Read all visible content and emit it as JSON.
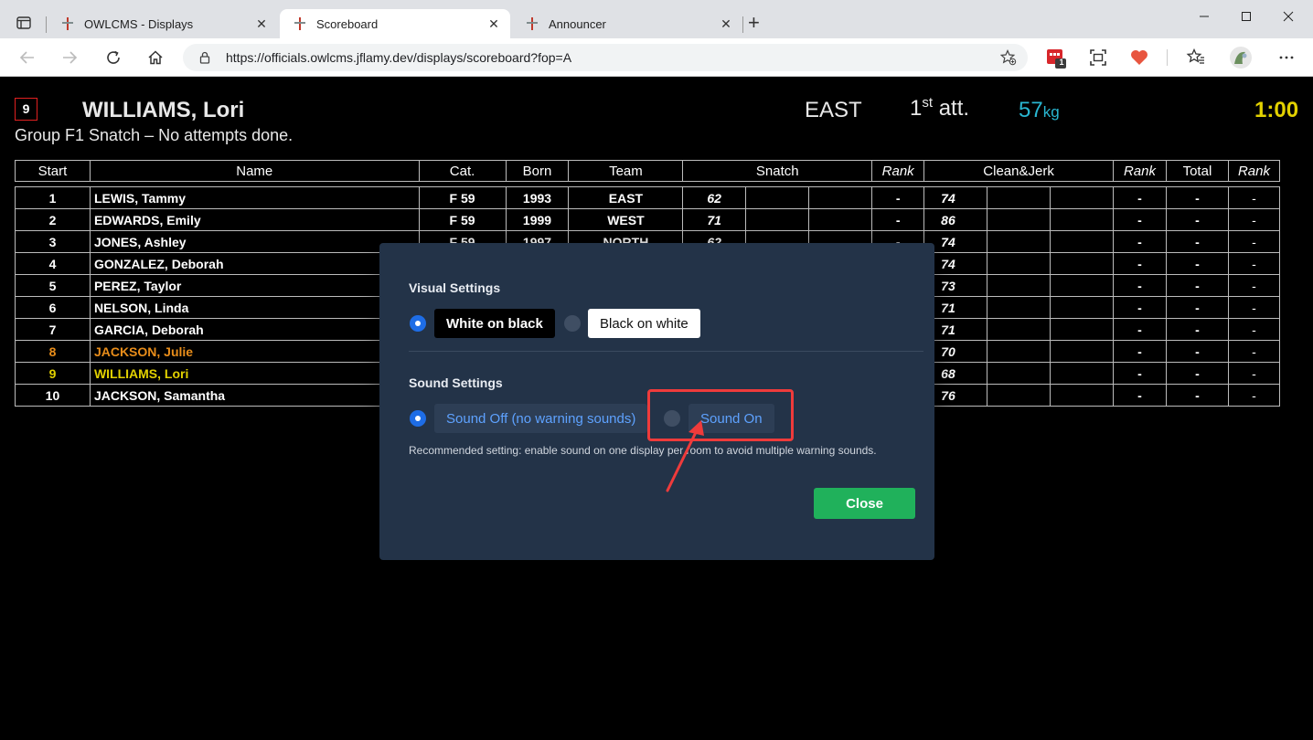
{
  "browser": {
    "tabs": [
      {
        "label": "OWLCMS - Displays"
      },
      {
        "label": "Scoreboard"
      },
      {
        "label": "Announcer"
      }
    ],
    "url": "https://officials.owlcms.jflamy.dev/displays/scoreboard?fop=A",
    "extension_badge": "1"
  },
  "current": {
    "start_number": "9",
    "name": "WILLIAMS, Lori",
    "team": "EAST",
    "attempt_num": "1",
    "attempt_sup": "st",
    "attempt_suffix": " att.",
    "weight": "57",
    "weight_unit": "kg",
    "timer": "1:00",
    "group_line": "Group F1 Snatch – No attempts done."
  },
  "table": {
    "headers": {
      "start": "Start",
      "name": "Name",
      "cat": "Cat.",
      "born": "Born",
      "team": "Team",
      "snatch": "Snatch",
      "rank1": "Rank",
      "cj": "Clean&Jerk",
      "rank2": "Rank",
      "total": "Total",
      "rank3": "Rank"
    },
    "rows": [
      {
        "start": "1",
        "name": "LEWIS, Tammy",
        "cat": "F 59",
        "born": "1993",
        "team": "EAST",
        "snatch": "62",
        "srank": "-",
        "cj": "74",
        "cjrank": "-",
        "total": "-",
        "trank": "-"
      },
      {
        "start": "2",
        "name": "EDWARDS, Emily",
        "cat": "F 59",
        "born": "1999",
        "team": "WEST",
        "snatch": "71",
        "srank": "-",
        "cj": "86",
        "cjrank": "-",
        "total": "-",
        "trank": "-"
      },
      {
        "start": "3",
        "name": "JONES, Ashley",
        "cat": "F 59",
        "born": "1997",
        "team": "NORTH",
        "snatch": "62",
        "srank": "-",
        "cj": "74",
        "cjrank": "-",
        "total": "-",
        "trank": "-"
      },
      {
        "start": "4",
        "name": "GONZALEZ, Deborah",
        "cat": "",
        "born": "",
        "team": "",
        "snatch": "",
        "srank": "-",
        "cj": "74",
        "cjrank": "-",
        "total": "-",
        "trank": "-"
      },
      {
        "start": "5",
        "name": "PEREZ, Taylor",
        "cat": "",
        "born": "",
        "team": "",
        "snatch": "",
        "srank": "-",
        "cj": "73",
        "cjrank": "-",
        "total": "-",
        "trank": "-"
      },
      {
        "start": "6",
        "name": "NELSON, Linda",
        "cat": "",
        "born": "",
        "team": "",
        "snatch": "",
        "srank": "-",
        "cj": "71",
        "cjrank": "-",
        "total": "-",
        "trank": "-"
      },
      {
        "start": "7",
        "name": "GARCIA, Deborah",
        "cat": "",
        "born": "",
        "team": "",
        "snatch": "",
        "srank": "-",
        "cj": "71",
        "cjrank": "-",
        "total": "-",
        "trank": "-"
      },
      {
        "start": "8",
        "name": "JACKSON, Julie",
        "cat": "",
        "born": "",
        "team": "",
        "snatch": "",
        "srank": "-",
        "cj": "70",
        "cjrank": "-",
        "total": "-",
        "trank": "-"
      },
      {
        "start": "9",
        "name": "WILLIAMS, Lori",
        "cat": "",
        "born": "",
        "team": "",
        "snatch": "",
        "srank": "-",
        "cj": "68",
        "cjrank": "-",
        "total": "-",
        "trank": "-"
      },
      {
        "start": "10",
        "name": "JACKSON, Samantha",
        "cat": "",
        "born": "",
        "team": "",
        "snatch": "",
        "srank": "-",
        "cj": "76",
        "cjrank": "-",
        "total": "-",
        "trank": "-"
      }
    ]
  },
  "dialog": {
    "visual_heading": "Visual Settings",
    "white_on_black": "White on black",
    "black_on_white": "Black on white",
    "sound_heading": "Sound Settings",
    "sound_off": "Sound Off (no warning sounds)",
    "sound_on": "Sound On",
    "note": "Recommended setting: enable sound on one display per room to avoid multiple warning sounds.",
    "close": "Close"
  },
  "colors": {
    "next_athlete": "#e88d1a",
    "current_athlete": "#e2d100",
    "weight": "#29b6d1",
    "dialog_bg": "#233348",
    "close_button": "#20b15b",
    "annotation": "#ef3b3b"
  }
}
